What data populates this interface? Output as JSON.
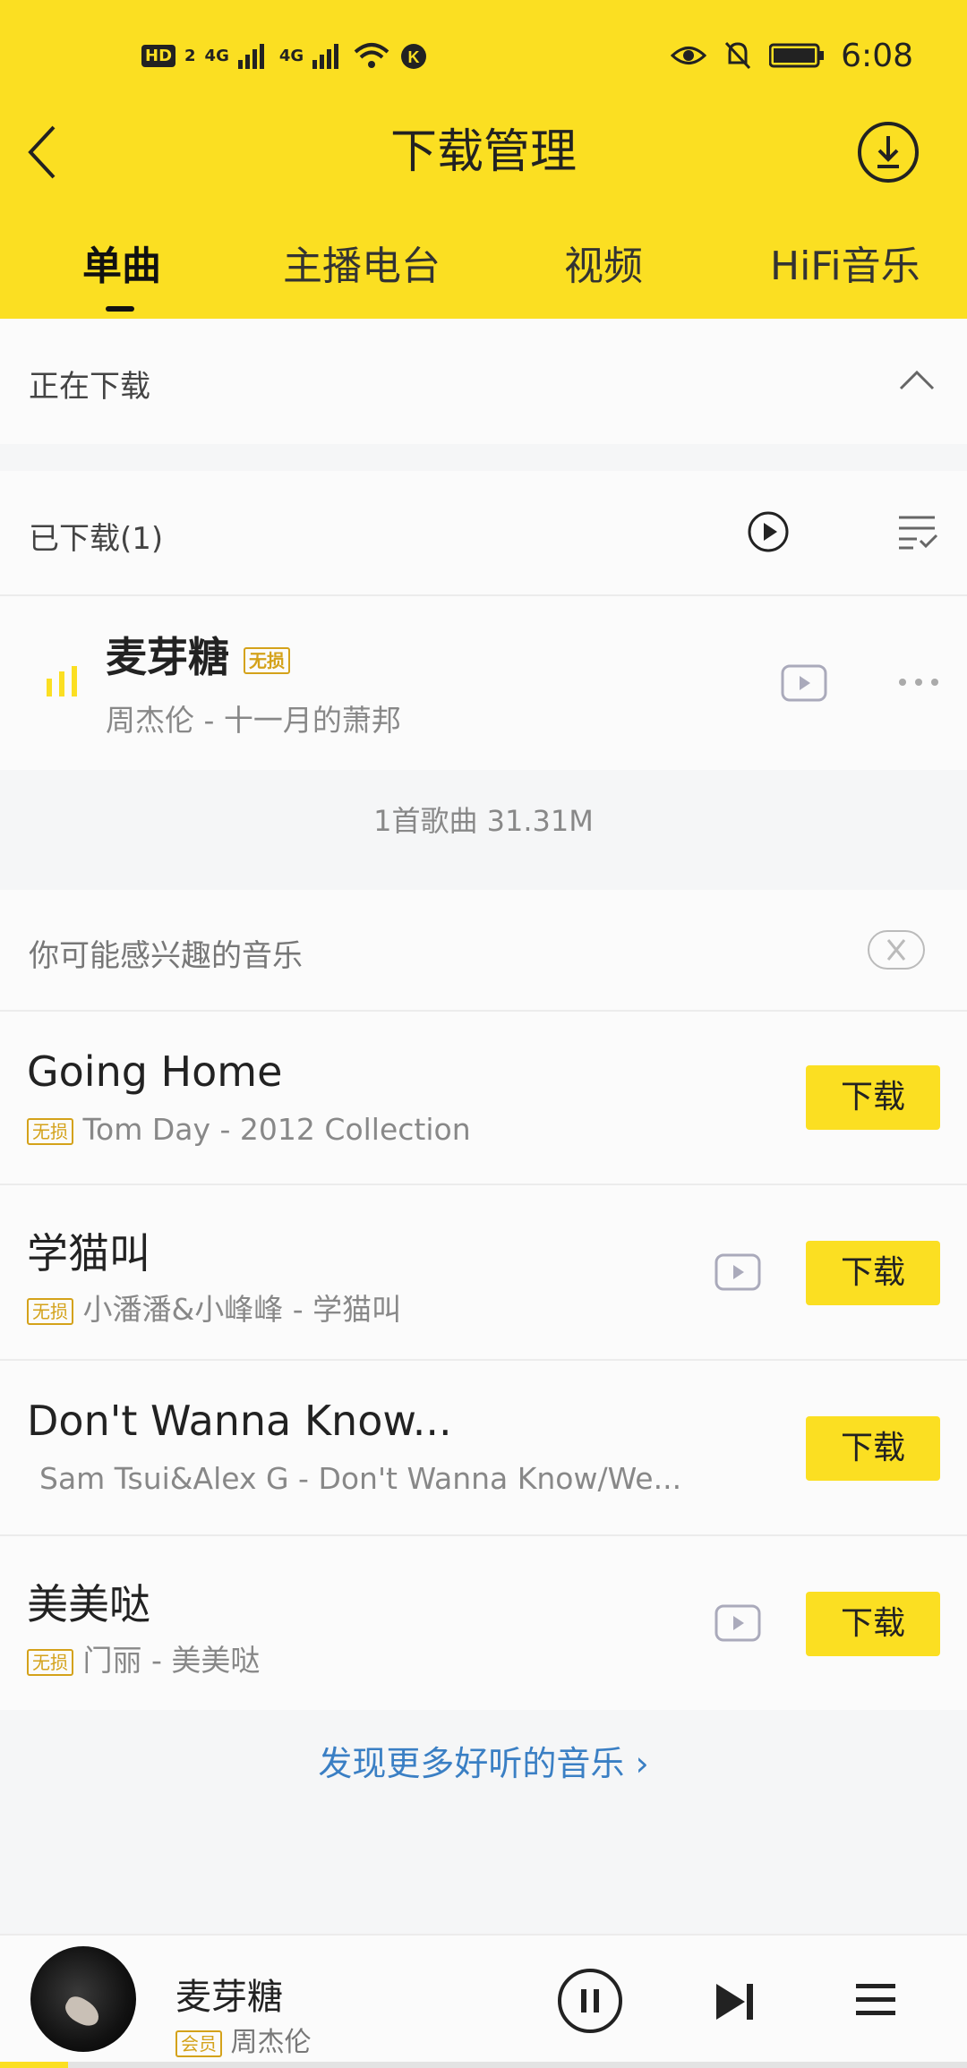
{
  "status_bar": {
    "time": "6:08",
    "network_label": "4G",
    "hd_label": "HD",
    "hd_sim": "2"
  },
  "header": {
    "title": "下载管理",
    "tabs": [
      {
        "label": "单曲",
        "active": true
      },
      {
        "label": "主播电台",
        "active": false
      },
      {
        "label": "视频",
        "active": false
      },
      {
        "label": "HiFi音乐",
        "active": false
      }
    ]
  },
  "downloading": {
    "label": "正在下载"
  },
  "downloaded": {
    "label": "已下载(1)",
    "songs": [
      {
        "title": "麦芽糖",
        "badge": "无损",
        "subtitle": "周杰伦 - 十一月的萧邦"
      }
    ],
    "summary": "1首歌曲 31.31M"
  },
  "recommend": {
    "label": "你可能感兴趣的音乐",
    "download_label": "下载",
    "items": [
      {
        "title": "Going Home",
        "badge": "无损",
        "subtitle": "Tom Day - 2012 Collection",
        "has_mv": false
      },
      {
        "title": "学猫叫",
        "badge": "无损",
        "subtitle": "小潘潘&小峰峰 - 学猫叫",
        "has_mv": true
      },
      {
        "title": "Don't Wanna Know...",
        "badge": "",
        "subtitle": "Sam Tsui&Alex G - Don't Wanna Know/We...",
        "has_mv": false
      },
      {
        "title": "美美哒",
        "badge": "无损",
        "subtitle": "门丽 - 美美哒",
        "has_mv": true
      }
    ],
    "discover_more": "发现更多好听的音乐"
  },
  "player": {
    "title": "麦芽糖",
    "badge": "会员",
    "artist": "周杰伦",
    "progress": 0.07
  },
  "colors": {
    "accent": "#fbdf22",
    "link": "#3a7fc4",
    "badge": "#d4a21a"
  }
}
